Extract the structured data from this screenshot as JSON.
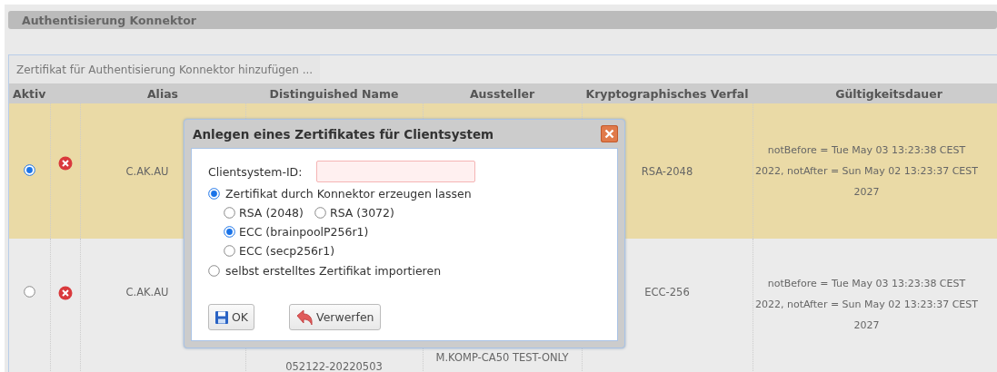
{
  "section": {
    "title": "Authentisierung Konnektor"
  },
  "add_button": {
    "label": "Zertifikat für Authentisierung Konnektor hinzufügen ..."
  },
  "table": {
    "columns": [
      "Aktiv",
      "Alias",
      "Distinguished Name",
      "Aussteller",
      "Kryptographisches Verfal",
      "Gültigkeitsdauer"
    ],
    "rows": [
      {
        "selected": true,
        "alias": "C.AK.AU",
        "crypto": "RSA-2048",
        "validity": "notBefore = Tue May 03 13:23:38 CEST 2022, notAfter = Sun May 02 13:23:37 CEST 2027"
      },
      {
        "selected": false,
        "alias": "C.AK.AU",
        "dn": "052122-20220503",
        "issuer": "M.KOMP-CA50 TEST-ONLY",
        "crypto": "ECC-256",
        "validity": "notBefore = Tue May 03 13:23:38 CEST 2022, notAfter = Sun May 02 13:23:37 CEST 2027"
      }
    ]
  },
  "dialog": {
    "title": "Anlegen eines Zertifikates für Clientsystem",
    "field": {
      "label": "Clientsystem-ID:",
      "invalid": true
    },
    "options": [
      {
        "label": "Zertifikat durch Konnektor erzeugen lassen",
        "selected": true,
        "sub_lines": [
          [
            {
              "label": "RSA (2048)",
              "selected": false
            },
            {
              "label": "RSA (3072)",
              "selected": false
            }
          ],
          [
            {
              "label": "ECC (brainpoolP256r1)",
              "selected": true
            }
          ],
          [
            {
              "label": "ECC (secp256r1)",
              "selected": false
            }
          ]
        ]
      },
      {
        "label": "selbst erstelltes Zertifikat importieren",
        "selected": false
      }
    ],
    "buttons": [
      {
        "kind": "save",
        "label": "OK"
      },
      {
        "kind": "discard",
        "label": "Verwerfen"
      }
    ]
  }
}
